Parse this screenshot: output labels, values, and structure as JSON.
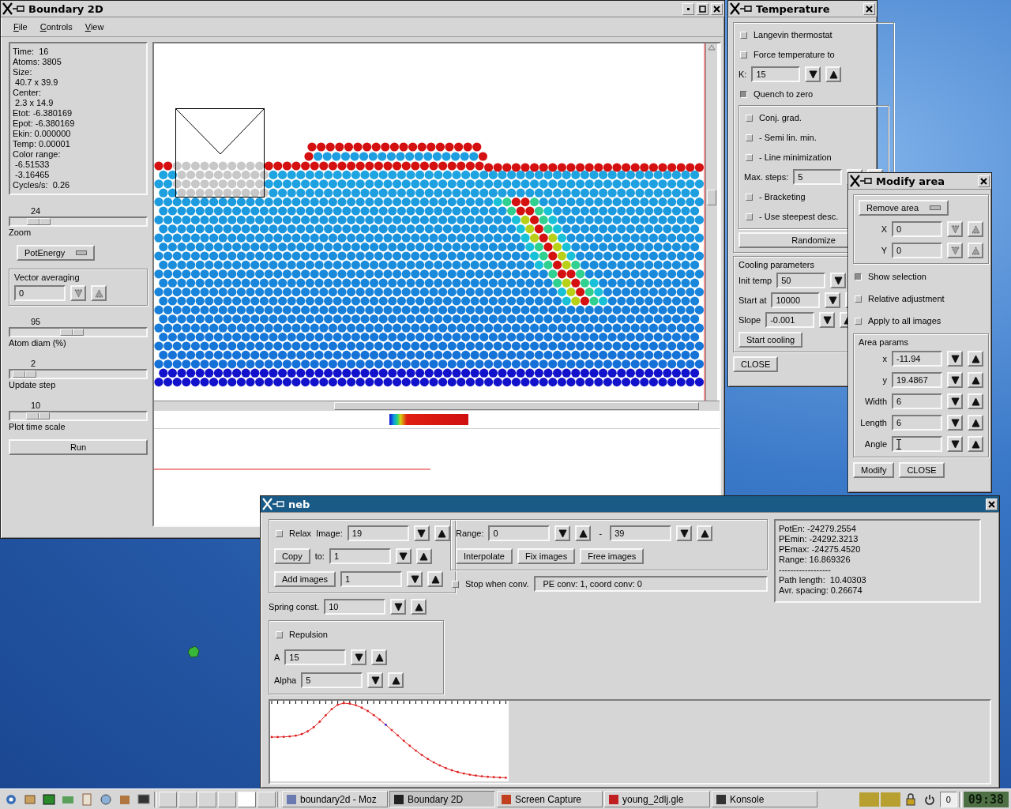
{
  "boundary_window": {
    "title": "Boundary 2D",
    "active": false,
    "menu": [
      "File",
      "Controls",
      "View"
    ],
    "info": [
      "Time:  16",
      "Atoms: 3805",
      "Size:",
      " 40.7 x 39.9",
      "Center:",
      " 2.3 x 14.9",
      "Etot: -6.380169",
      "Epot: -6.380169",
      "Ekin: 0.000000",
      "Temp: 0.00001",
      "Color range:",
      " -6.51533",
      " -3.16465",
      "Cycles/s:  0.26"
    ],
    "controls": [
      {
        "kind": "slider",
        "value": "24",
        "label": "Zoom",
        "level": 0.15
      },
      {
        "kind": "dropdown",
        "label": "PotEnergy"
      },
      {
        "kind": "group",
        "title": "Vector averaging",
        "rows": [
          [
            {
              "kind": "spin",
              "value": "0",
              "disabled": true
            }
          ]
        ]
      },
      {
        "kind": "slider",
        "value": "95",
        "label": "Atom diam (%)",
        "level": 0.45
      },
      {
        "kind": "slider",
        "value": "2",
        "label": "Update step",
        "level": 0.02
      },
      {
        "kind": "slider",
        "value": "10",
        "label": "Plot time scale",
        "level": 0.14
      },
      {
        "kind": "wide_button",
        "label": "Run"
      }
    ]
  },
  "temperature_window": {
    "title": "Temperature",
    "active": false,
    "rows": [
      [
        {
          "kind": "group",
          "rows": [
            [
              {
                "kind": "check",
                "label": "Langevin thermostat",
                "checked": false
              }
            ],
            [
              {
                "kind": "check",
                "label": "Force temperature to",
                "checked": false
              }
            ],
            [
              {
                "kind": "spin",
                "label": "K:",
                "value": "15"
              }
            ],
            [
              {
                "kind": "check",
                "label": "Quench to zero",
                "checked": true
              }
            ],
            [
              {
                "kind": "group",
                "rows": [
                  [
                    {
                      "kind": "check",
                      "label": "Conj. grad.",
                      "checked": false
                    }
                  ],
                  [
                    {
                      "kind": "check",
                      "label": "- Semi lin. min.",
                      "checked": false
                    }
                  ],
                  [
                    {
                      "kind": "check",
                      "label": "- Line minimization",
                      "checked": false
                    }
                  ],
                  [
                    {
                      "kind": "spin",
                      "label": "Max. steps:",
                      "value": "5"
                    }
                  ],
                  [
                    {
                      "kind": "check",
                      "label": "- Bracketing",
                      "checked": false
                    }
                  ],
                  [
                    {
                      "kind": "check",
                      "label": "- Use steepest desc.",
                      "checked": false
                    }
                  ]
                ]
              }
            ],
            [
              {
                "kind": "wide_button",
                "label": "Randomize"
              }
            ]
          ]
        }
      ],
      [
        {
          "kind": "group",
          "title": "Cooling parameters",
          "rows": [
            [
              {
                "kind": "spin",
                "label": "Init temp",
                "value": "50"
              }
            ],
            [
              {
                "kind": "spin",
                "label": "Start at",
                "value": "10000"
              }
            ],
            [
              {
                "kind": "spin",
                "label": "Slope",
                "value": "-0.001"
              }
            ],
            [
              {
                "kind": "button",
                "label": "Start cooling"
              }
            ]
          ]
        }
      ],
      [
        {
          "kind": "button",
          "label": "CLOSE"
        }
      ]
    ]
  },
  "modify_window": {
    "title": "Modify area",
    "active": false,
    "rows": [
      [
        {
          "kind": "group",
          "rows": [
            [
              {
                "kind": "dropdown",
                "label": "Remove area"
              }
            ],
            [
              {
                "kind": "spin",
                "label": "X",
                "value": "0",
                "disabled": true
              }
            ],
            [
              {
                "kind": "spin",
                "label": "Y",
                "value": "0",
                "disabled": true
              }
            ]
          ]
        }
      ],
      [
        {
          "kind": "check",
          "label": "Show selection",
          "checked": true
        }
      ],
      [
        {
          "kind": "check",
          "label": "Relative adjustment",
          "checked": false
        }
      ],
      [
        {
          "kind": "check",
          "label": "Apply to all images",
          "checked": false
        }
      ],
      [
        {
          "kind": "group",
          "title": "Area params",
          "rows": [
            [
              {
                "kind": "spin",
                "label": "x",
                "value": "-11.94"
              }
            ],
            [
              {
                "kind": "spin",
                "label": "y",
                "value": "19.4867"
              }
            ],
            [
              {
                "kind": "spin",
                "label": "Width",
                "value": "6"
              }
            ],
            [
              {
                "kind": "spin",
                "label": "Length",
                "value": "6"
              }
            ],
            [
              {
                "kind": "spin",
                "label": "Angle",
                "cursor": true
              }
            ]
          ]
        }
      ],
      [
        {
          "kind": "button",
          "label": "Modify"
        },
        {
          "kind": "button",
          "label": "CLOSE"
        }
      ]
    ]
  },
  "neb_window": {
    "title": "neb",
    "active": true,
    "left": [
      [
        {
          "kind": "group",
          "rows": [
            [
              {
                "kind": "check",
                "label": "Relax",
                "checked": false
              },
              {
                "kind": "spin",
                "label": "Image:",
                "value": "19"
              }
            ],
            [
              {
                "kind": "button",
                "label": "Copy"
              },
              {
                "kind": "spin",
                "label": "to:",
                "value": "1"
              }
            ],
            [
              {
                "kind": "button",
                "label": "Add images"
              },
              {
                "kind": "spin",
                "value": "1"
              }
            ]
          ]
        }
      ],
      [
        {
          "kind": "spin",
          "label": "Spring const.",
          "value": "10"
        }
      ],
      [
        {
          "kind": "group",
          "rows": [
            [
              {
                "kind": "check",
                "label": "Repulsion",
                "checked": false
              }
            ],
            [
              {
                "kind": "spin",
                "label": "A",
                "value": "15"
              }
            ],
            [
              {
                "kind": "spin",
                "label": "Alpha",
                "value": "5"
              }
            ]
          ]
        }
      ]
    ],
    "middle": [
      [
        {
          "kind": "group",
          "rows": [
            [
              {
                "kind": "range",
                "label": "Range:",
                "from": "0",
                "separator": "-",
                "to": "39"
              }
            ],
            [
              {
                "kind": "button",
                "label": "Interpolate"
              },
              {
                "kind": "button",
                "label": "Fix images"
              },
              {
                "kind": "button",
                "label": "Free images"
              }
            ]
          ]
        }
      ],
      [
        {
          "kind": "check",
          "label": "Stop when conv.",
          "checked": false
        },
        {
          "kind": "status",
          "value": "PE conv: 1, coord conv: 0"
        }
      ]
    ],
    "info": [
      "PotEn: -24279.2554",
      "PEmin: -24292.3213",
      "PEmax: -24275.4520",
      "Range: 16.869326",
      "------------------",
      "Path length:  10.40303",
      "Avr. spacing: 0.26674"
    ]
  },
  "taskbar": {
    "tasks": [
      {
        "label": "boundary2d - Moz",
        "selected": false
      },
      {
        "label": "Boundary 2D",
        "selected": true
      },
      {
        "label": "Screen Capture",
        "selected": false
      },
      {
        "label": "young_2dlj.gle",
        "selected": false
      },
      {
        "label": "Konsole",
        "selected": false
      }
    ],
    "counter": "0",
    "clock": "09:38"
  }
}
